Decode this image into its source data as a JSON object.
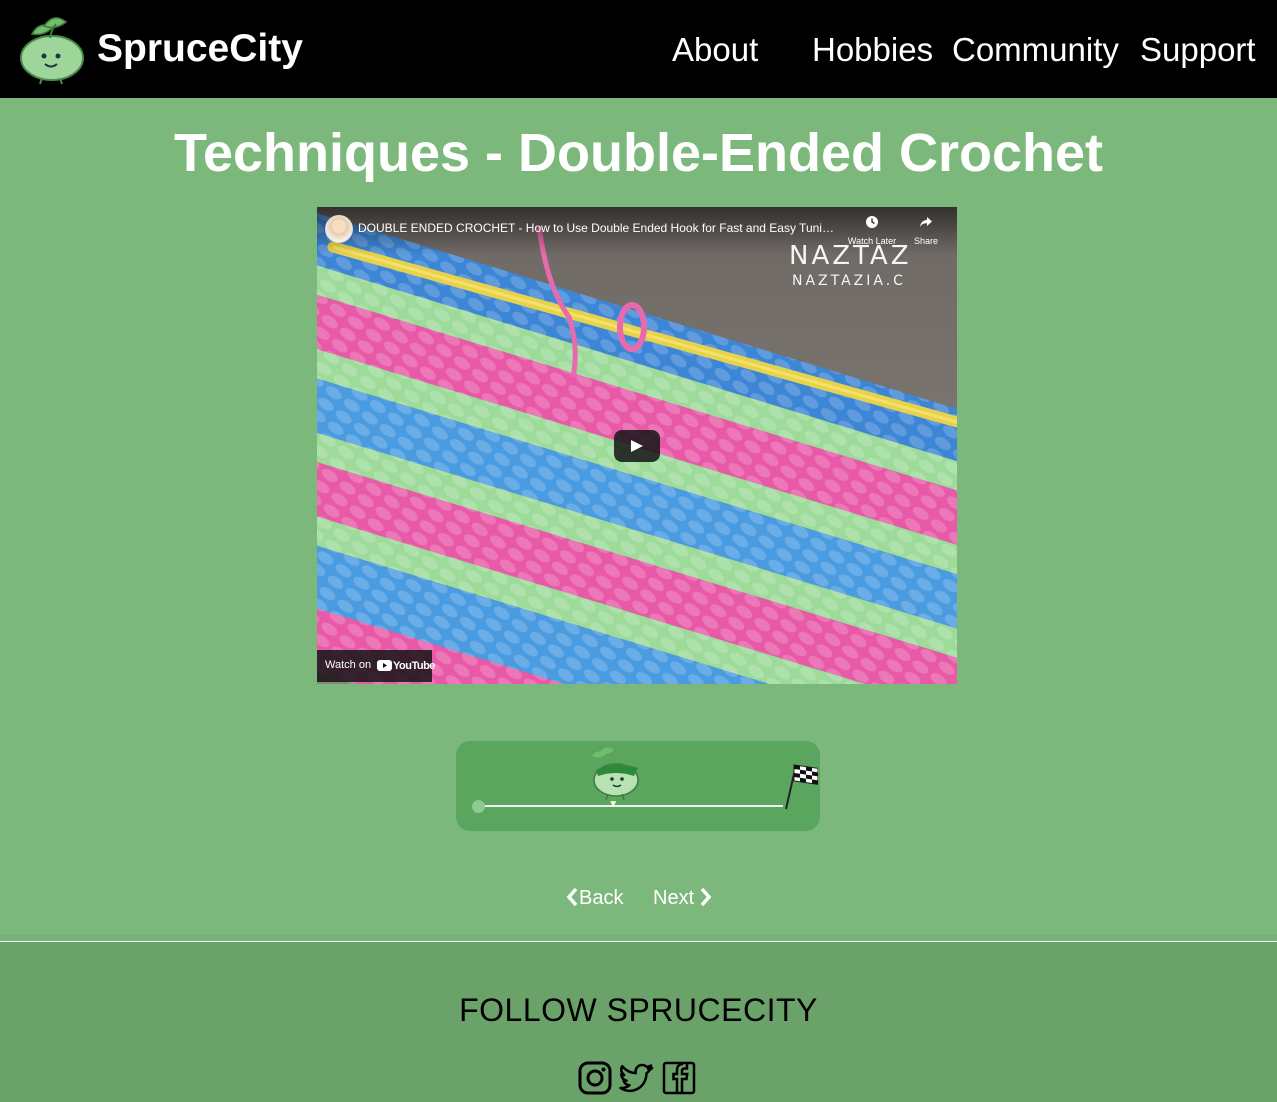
{
  "header": {
    "brand": "SpruceCity",
    "nav": [
      "About",
      "Hobbies",
      "Community",
      "Support"
    ]
  },
  "page": {
    "title": "Techniques - Double-Ended Crochet"
  },
  "video": {
    "title": "DOUBLE ENDED CROCHET - How to Use Double Ended Hook for Fast and Easy Tunisian ...",
    "watch_later": "Watch Later",
    "share": "Share",
    "watermark_main": "NAZTAZ",
    "watermark_sub": "NAZTAZIA.C",
    "watch_on": "Watch on",
    "youtube": "YouTube"
  },
  "progress": {
    "fraction": 0.44
  },
  "pager": {
    "back": "Back",
    "next": "Next"
  },
  "footer": {
    "follow": "FOLLOW SPRUCECITY",
    "social_icons": [
      "instagram-icon",
      "twitter-icon",
      "facebook-icon"
    ]
  },
  "colors": {
    "header_bg": "#000000",
    "page_bg": "#7cb87c",
    "progress_bg": "#5aa65e",
    "footer_bg": "#6aa26a"
  }
}
